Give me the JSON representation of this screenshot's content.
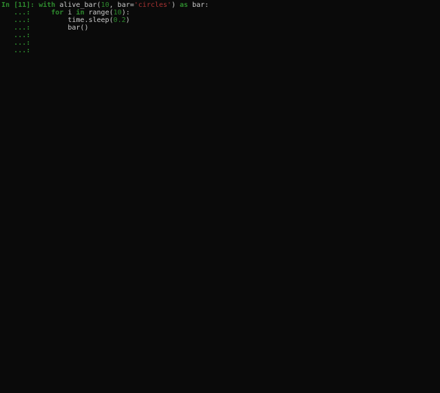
{
  "prompt": {
    "in_label": "In ",
    "open_bracket": "[",
    "number": "11",
    "close_bracket": "]:",
    "continuation": "   ...:"
  },
  "code": {
    "line1": {
      "kw_with": "with",
      "sp1": " ",
      "fn": "alive_bar",
      "op_paren": "(",
      "num1": "10",
      "comma": ",",
      "sp2": " ",
      "arg_name": "bar",
      "eq": "=",
      "str_val": "'circles'",
      "cl_paren": ")",
      "sp3": " ",
      "kw_as": "as",
      "sp4": " ",
      "var": "bar",
      "colon": ":"
    },
    "line2": {
      "indent": "     ",
      "kw_for": "for",
      "sp1": " ",
      "var": "i",
      "sp2": " ",
      "kw_in": "in",
      "sp3": " ",
      "fn": "range",
      "op_paren": "(",
      "num": "10",
      "cl_paren": ")",
      "colon": ":"
    },
    "line3": {
      "indent": "         ",
      "mod": "time",
      "dot": ".",
      "fn": "sleep",
      "op_paren": "(",
      "num": "0.2",
      "cl_paren": ")"
    },
    "line4": {
      "indent": "         ",
      "fn": "bar",
      "op_paren": "(",
      "cl_paren": ")"
    }
  }
}
